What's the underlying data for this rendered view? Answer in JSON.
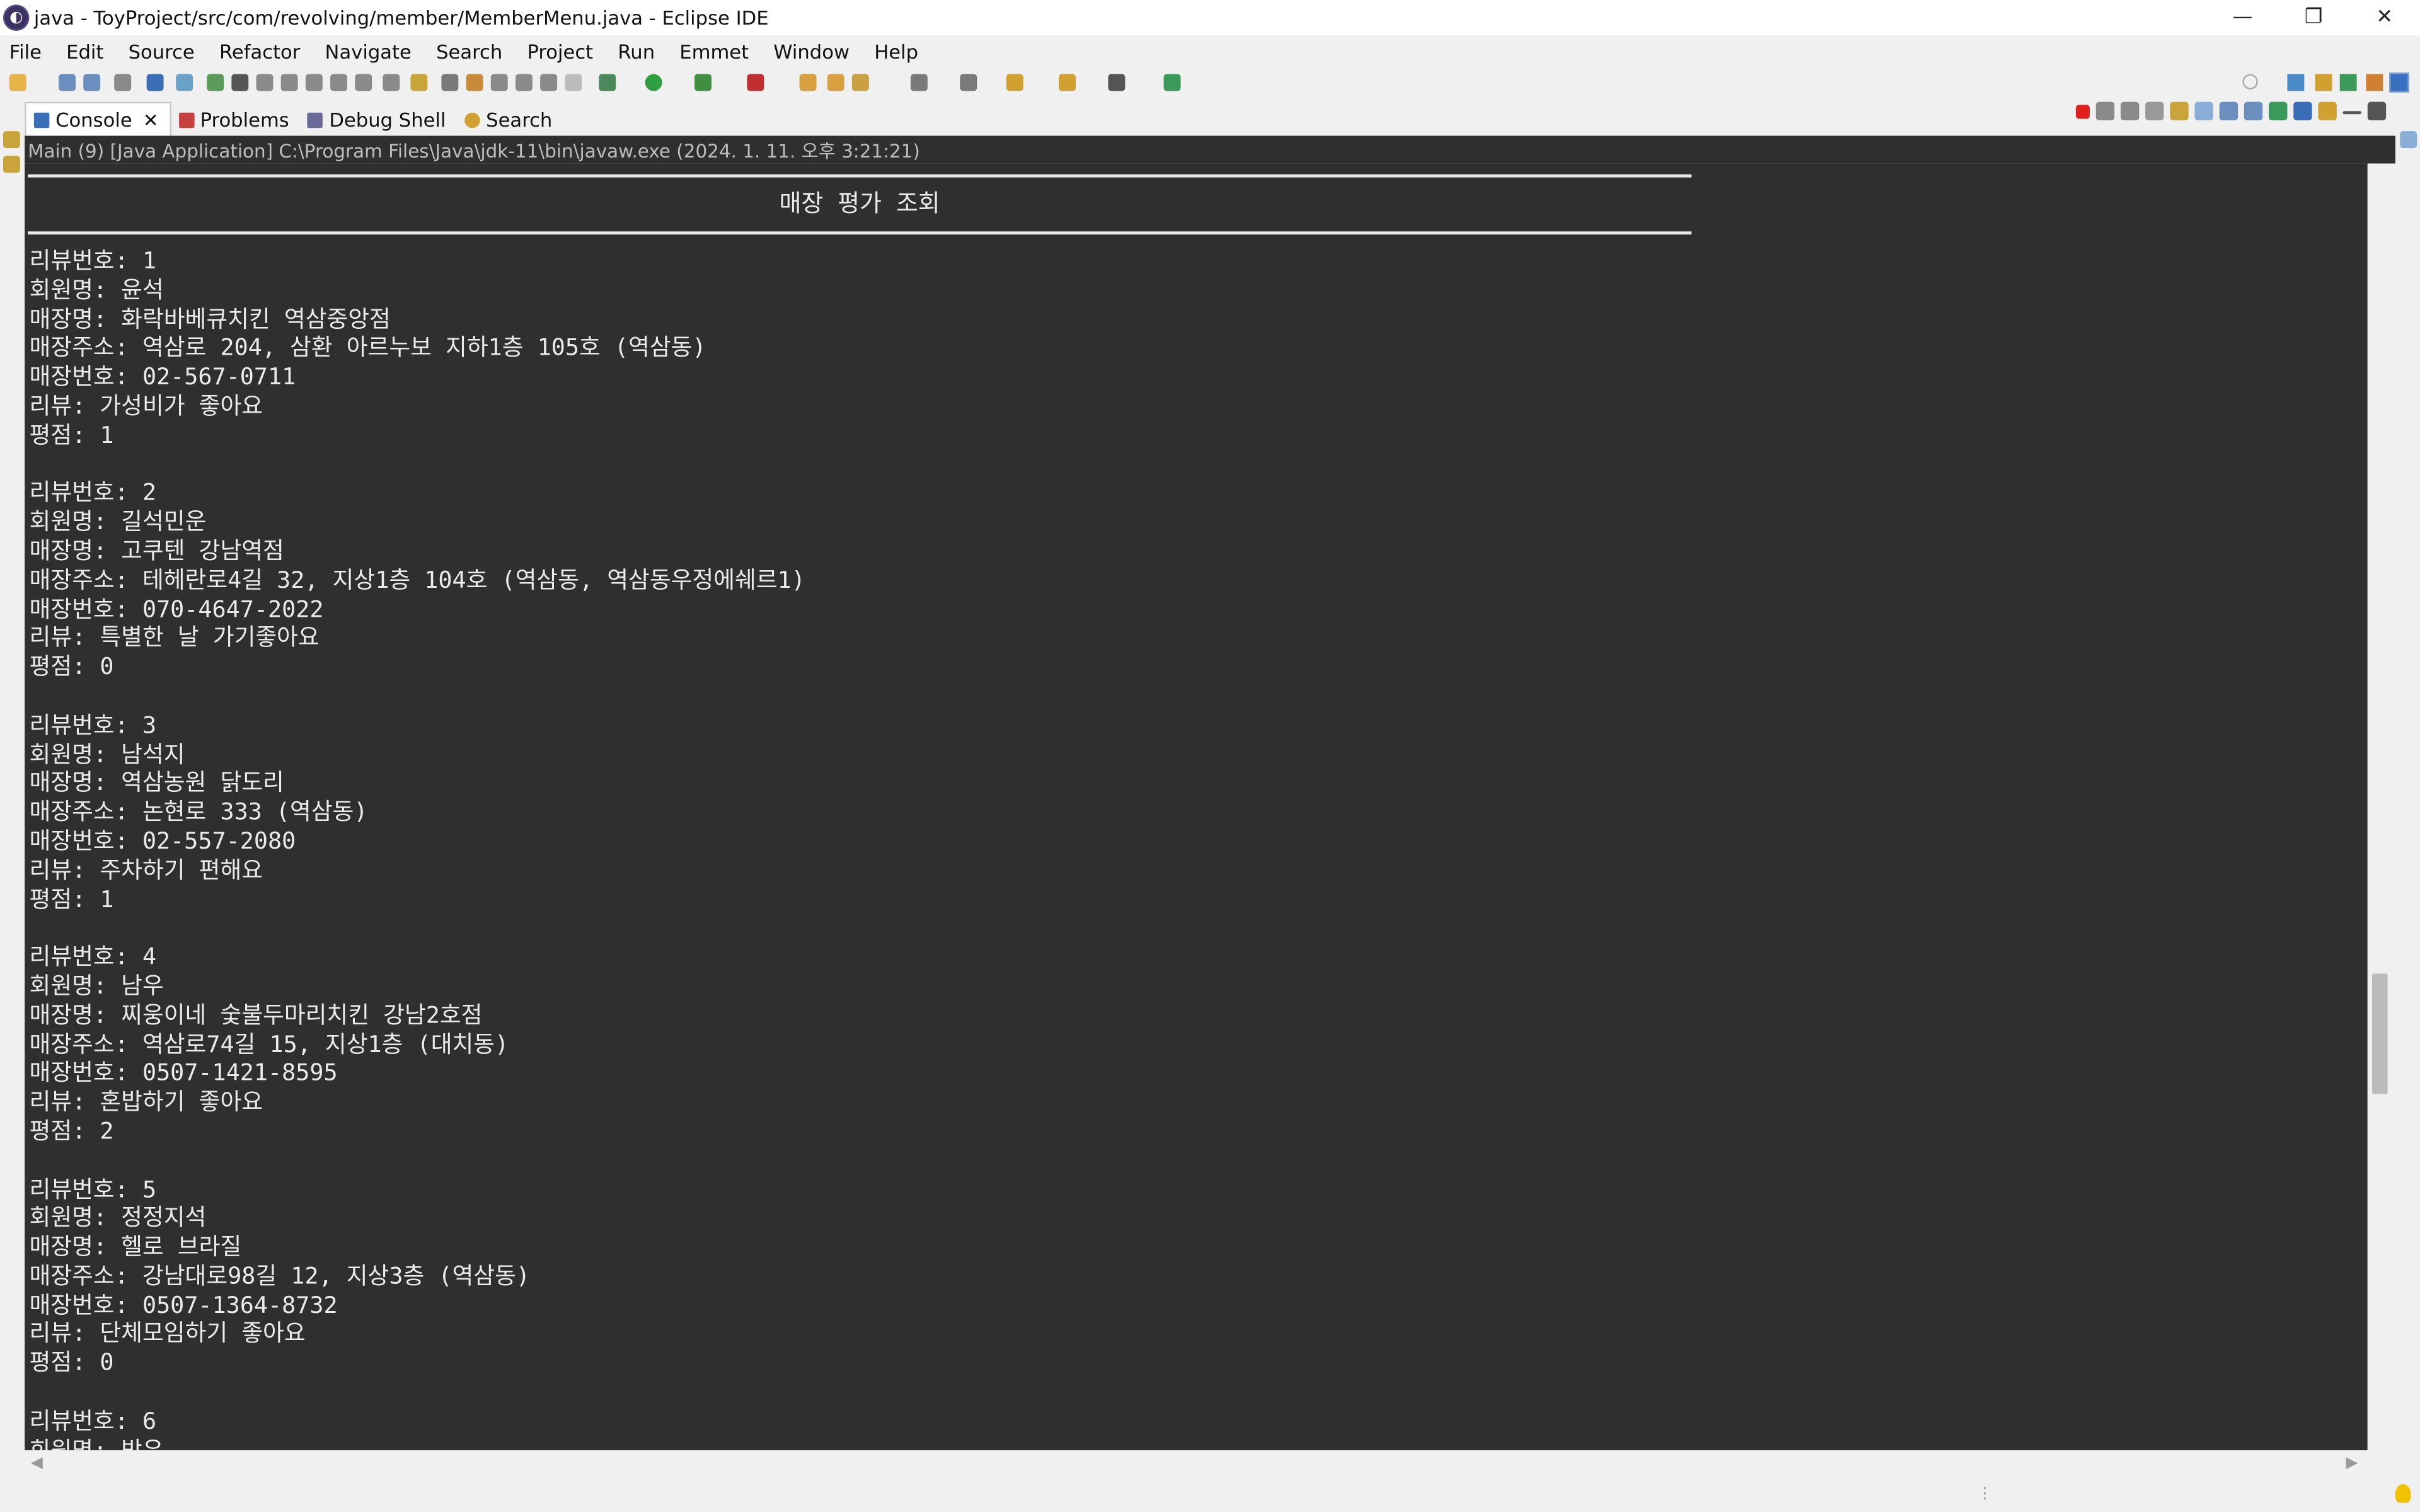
{
  "window": {
    "title": "java - ToyProject/src/com/revolving/member/MemberMenu.java - Eclipse IDE",
    "minimize_glyph": "—",
    "restore_glyph": "❐",
    "close_glyph": "✕"
  },
  "menu": [
    "File",
    "Edit",
    "Source",
    "Refactor",
    "Navigate",
    "Search",
    "Project",
    "Run",
    "Emmet",
    "Window",
    "Help"
  ],
  "tabs": [
    {
      "label": "Console",
      "active": true,
      "close": "✕"
    },
    {
      "label": "Problems",
      "active": false
    },
    {
      "label": "Debug Shell",
      "active": false
    },
    {
      "label": "Search",
      "active": false
    }
  ],
  "process_line": "Main (9) [Java Application] C:\\Program Files\\Java\\jdk-11\\bin\\javaw.exe  (2024. 1. 11. 오후 3:21:21)",
  "console": {
    "header_title": "매장 평가 조회",
    "lines": [
      "리뷰번호: 1",
      "회원명: 윤석",
      "매장명: 화락바베큐치킨 역삼중앙점",
      "매장주소: 역삼로 204, 삼환 아르누보 지하1층 105호 (역삼동)",
      "매장번호: 02-567-0711",
      "리뷰: 가성비가 좋아요",
      "평점: 1",
      "",
      "리뷰번호: 2",
      "회원명: 길석민운",
      "매장명: 고쿠텐 강남역점",
      "매장주소: 테헤란로4길 32, 지상1층 104호 (역삼동, 역삼동우정에쉐르1)",
      "매장번호: 070-4647-2022",
      "리뷰: 특별한 날 가기좋아요",
      "평점: 0",
      "",
      "리뷰번호: 3",
      "회원명: 남석지",
      "매장명: 역삼농원 닭도리",
      "매장주소: 논현로 333 (역삼동)",
      "매장번호: 02-557-2080",
      "리뷰: 주차하기 편해요",
      "평점: 1",
      "",
      "리뷰번호: 4",
      "회원명: 남우",
      "매장명: 찌웅이네 숯불두마리치킨 강남2호점",
      "매장주소: 역삼로74길 15, 지상1층 (대치동)",
      "매장번호: 0507-1421-8595",
      "리뷰: 혼밥하기 좋아요",
      "평점: 2",
      "",
      "리뷰번호: 5",
      "회원명: 정정지석",
      "매장명: 헬로 브라질",
      "매장주소: 강남대로98길 12, 지상3층 (역삼동)",
      "매장번호: 0507-1364-8732",
      "리뷰: 단체모임하기 좋아요",
      "평점: 0",
      "",
      "리뷰번호: 6",
      "회원명: 박유"
    ]
  },
  "icons": {
    "app": "eclipse-icon",
    "console_tab": "console-icon",
    "problems_tab": "problems-icon",
    "debug_shell_tab": "debug-shell-icon",
    "search_tab": "search-icon",
    "terminate": "terminate-icon",
    "lightbulb": "lightbulb-icon"
  },
  "colors": {
    "console_bg": "#2f2f2f",
    "console_fg": "#ebebeb",
    "terminate_red": "#e0201d"
  }
}
